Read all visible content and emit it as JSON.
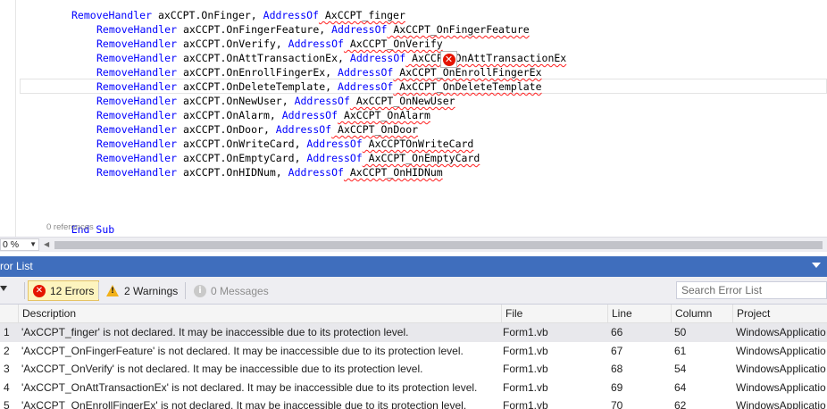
{
  "editor": {
    "lines": [
      {
        "indent": "",
        "kw1": "RemoveHandler",
        "mid": " axCCPT.OnFinger, ",
        "kw2": "AddressOf",
        "tail": " AxCCPT_finger"
      },
      {
        "indent": "    ",
        "kw1": "RemoveHandler",
        "mid": " axCCPT.OnFingerFeature, ",
        "kw2": "AddressOf",
        "tail": " AxCCPT_OnFingerFeature"
      },
      {
        "indent": "    ",
        "kw1": "RemoveHandler",
        "mid": " axCCPT.OnVerify, ",
        "kw2": "AddressOf",
        "tail": " AxCCPT_OnVerify"
      },
      {
        "indent": "    ",
        "kw1": "RemoveHandler",
        "mid": " axCCPT.OnAttTransactionEx, ",
        "kw2": "AddressOf",
        "tail": " AxCCPT_OnAttTransactionEx"
      },
      {
        "indent": "    ",
        "kw1": "RemoveHandler",
        "mid": " axCCPT.OnEnrollFingerEx, ",
        "kw2": "AddressOf",
        "tail": " AxCCPT_OnEnrollFingerEx"
      },
      {
        "indent": "    ",
        "kw1": "RemoveHandler",
        "mid": " axCCPT.OnDeleteTemplate, ",
        "kw2": "AddressOf",
        "tail": " AxCCPT_OnDeleteTemplate"
      },
      {
        "indent": "    ",
        "kw1": "RemoveHandler",
        "mid": " axCCPT.OnNewUser, ",
        "kw2": "AddressOf",
        "tail": " AxCCPT_OnNewUser"
      },
      {
        "indent": "    ",
        "kw1": "RemoveHandler",
        "mid": " axCCPT.OnAlarm, ",
        "kw2": "AddressOf",
        "tail": " AxCCPT_OnAlarm"
      },
      {
        "indent": "    ",
        "kw1": "RemoveHandler",
        "mid": " axCCPT.OnDoor, ",
        "kw2": "AddressOf",
        "tail": " AxCCPT_OnDoor"
      },
      {
        "indent": "    ",
        "kw1": "RemoveHandler",
        "mid": " axCCPT.OnWriteCard, ",
        "kw2": "AddressOf",
        "tail": " AxCCPTOnWriteCard"
      },
      {
        "indent": "    ",
        "kw1": "RemoveHandler",
        "mid": " axCCPT.OnEmptyCard, ",
        "kw2": "AddressOf",
        "tail": " AxCCPT_OnEmptyCard"
      },
      {
        "indent": "    ",
        "kw1": "RemoveHandler",
        "mid": " axCCPT.OnHIDNum, ",
        "kw2": "AddressOf",
        "tail": " AxCCPT_OnHIDNum"
      }
    ],
    "end_sub": "End Sub",
    "references": "0 references",
    "zoom": "0 %",
    "error_glyph": "✕"
  },
  "panel": {
    "title": "ror List"
  },
  "toolbar": {
    "errors_label": "12 Errors",
    "warnings_label": "2 Warnings",
    "messages_label": "0 Messages",
    "search_placeholder": "Search Error List"
  },
  "grid": {
    "columns": [
      "Description",
      "File",
      "Line",
      "Column",
      "Project"
    ],
    "rows": [
      {
        "num": "1",
        "description": "'AxCCPT_finger' is not declared. It may be inaccessible due to its protection level.",
        "file": "Form1.vb",
        "line": "66",
        "column": "50",
        "project": "WindowsApplicatio"
      },
      {
        "num": "2",
        "description": "'AxCCPT_OnFingerFeature' is not declared. It may be inaccessible due to its protection level.",
        "file": "Form1.vb",
        "line": "67",
        "column": "61",
        "project": "WindowsApplicatio"
      },
      {
        "num": "3",
        "description": "'AxCCPT_OnVerify' is not declared. It may be inaccessible due to its protection level.",
        "file": "Form1.vb",
        "line": "68",
        "column": "54",
        "project": "WindowsApplicatio"
      },
      {
        "num": "4",
        "description": "'AxCCPT_OnAttTransactionEx' is not declared. It may be inaccessible due to its protection level.",
        "file": "Form1.vb",
        "line": "69",
        "column": "64",
        "project": "WindowsApplicatio"
      },
      {
        "num": "5",
        "description": "'AxCCPT_OnEnrollFingerEx' is not declared. It may be inaccessible due to its protection level.",
        "file": "Form1.vb",
        "line": "70",
        "column": "62",
        "project": "WindowsApplicatio"
      }
    ]
  },
  "colors": {
    "panel_header": "#3f6ebd",
    "keyword": "#0000ff",
    "error": "#e51400",
    "warning": "#f2b11a"
  }
}
